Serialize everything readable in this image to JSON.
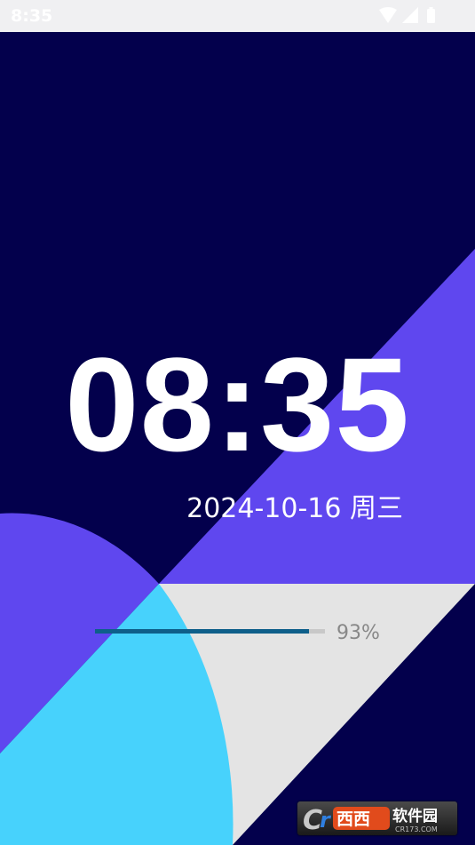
{
  "status_bar": {
    "time": "8:35",
    "icons": [
      "wifi-icon",
      "signal-icon",
      "battery-icon"
    ]
  },
  "lockscreen": {
    "clock": "08:35",
    "date": "2024-10-16 周三",
    "battery_percent_label": "93%",
    "battery_level": 0.93
  },
  "watermark": {
    "brand": "西西软件园",
    "url": "CR173.COM"
  },
  "colors": {
    "background_navy": "#03004c",
    "accent_purple": "#5f47ef",
    "accent_cyan": "#47d2fc",
    "light_gray": "#e4e4e4",
    "progress_fill": "#0e5f8a"
  }
}
